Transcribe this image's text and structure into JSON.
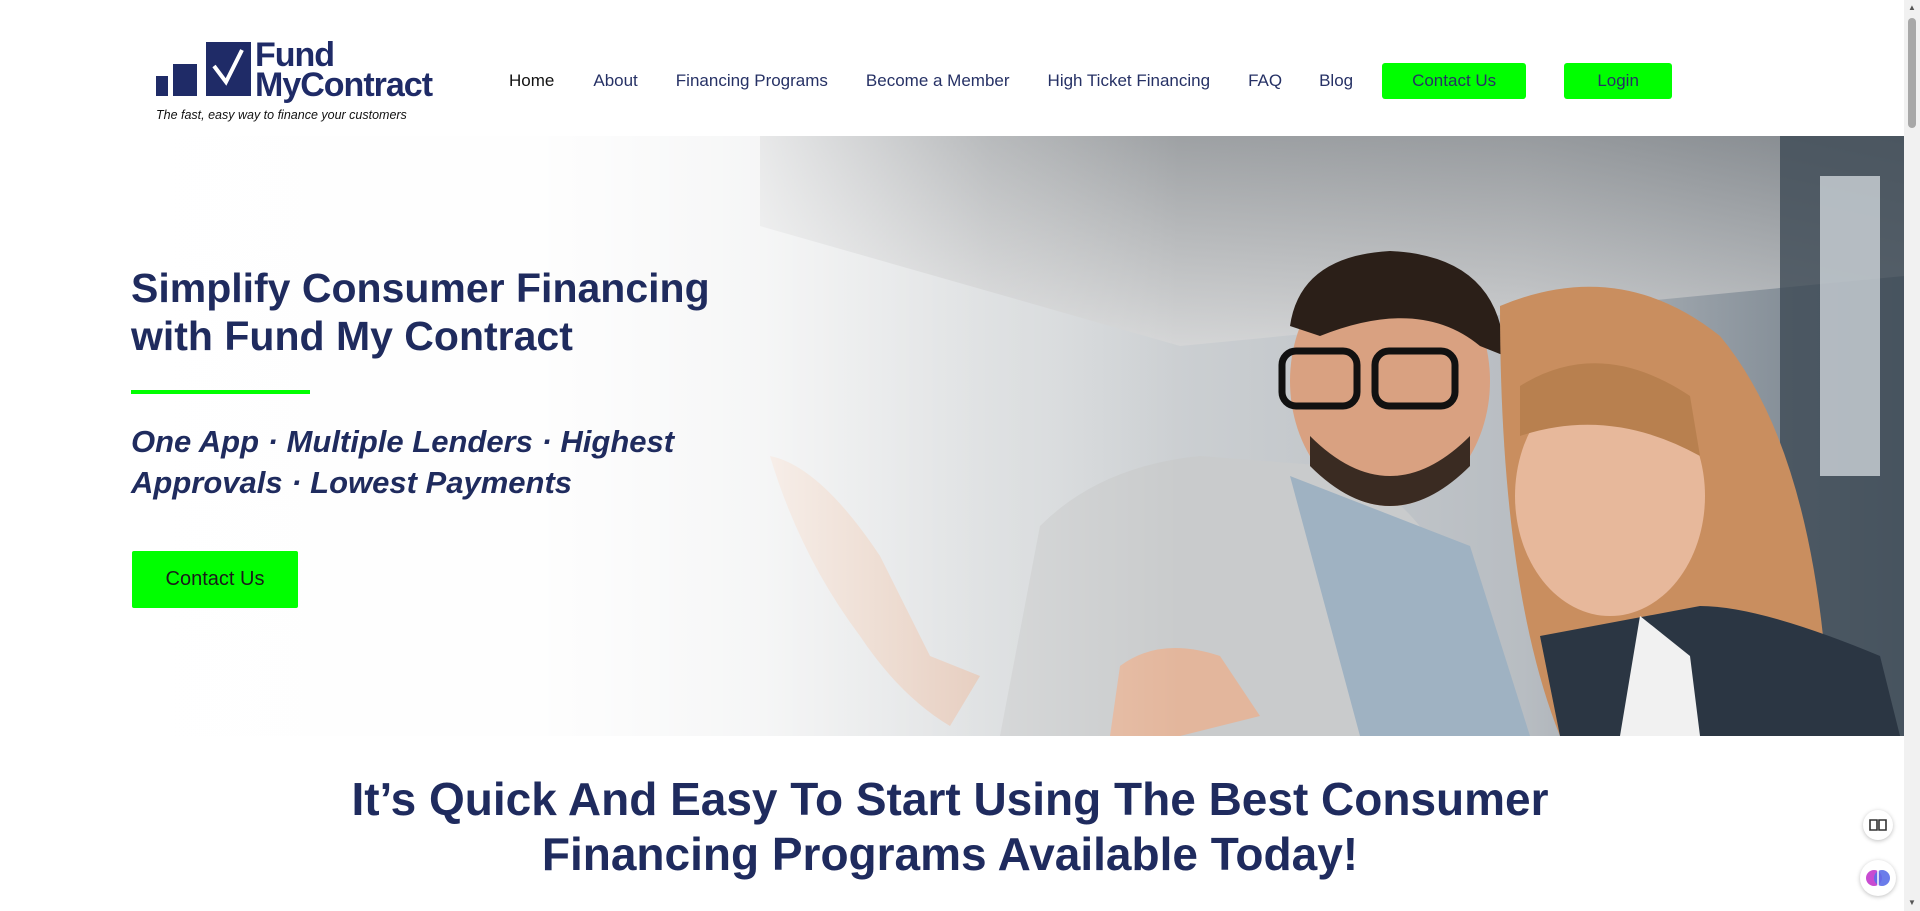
{
  "logo": {
    "word1": "Fund",
    "word2": "MyContract",
    "tagline": "The fast, easy way to finance your customers"
  },
  "nav": {
    "items": [
      {
        "label": "Home"
      },
      {
        "label": "About"
      },
      {
        "label": "Financing Programs"
      },
      {
        "label": "Become a Member"
      },
      {
        "label": "High Ticket Financing"
      },
      {
        "label": "FAQ"
      },
      {
        "label": "Blog"
      }
    ],
    "contact_label": "Contact Us",
    "login_label": "Login"
  },
  "hero": {
    "title": "Simplify Consumer Financing with Fund My Contract",
    "subtitle": "One App · Multiple Lenders · Highest Approvals · Lowest Payments",
    "cta_label": "Contact Us"
  },
  "section": {
    "title": "It’s Quick And Easy To Start Using The Best Consumer Financing Programs Available Today!"
  },
  "colors": {
    "brand_navy": "#1f2b5e",
    "accent_green": "#00ff00"
  },
  "icons": {
    "reader": "book-open-icon",
    "assistant": "brain-icon"
  }
}
